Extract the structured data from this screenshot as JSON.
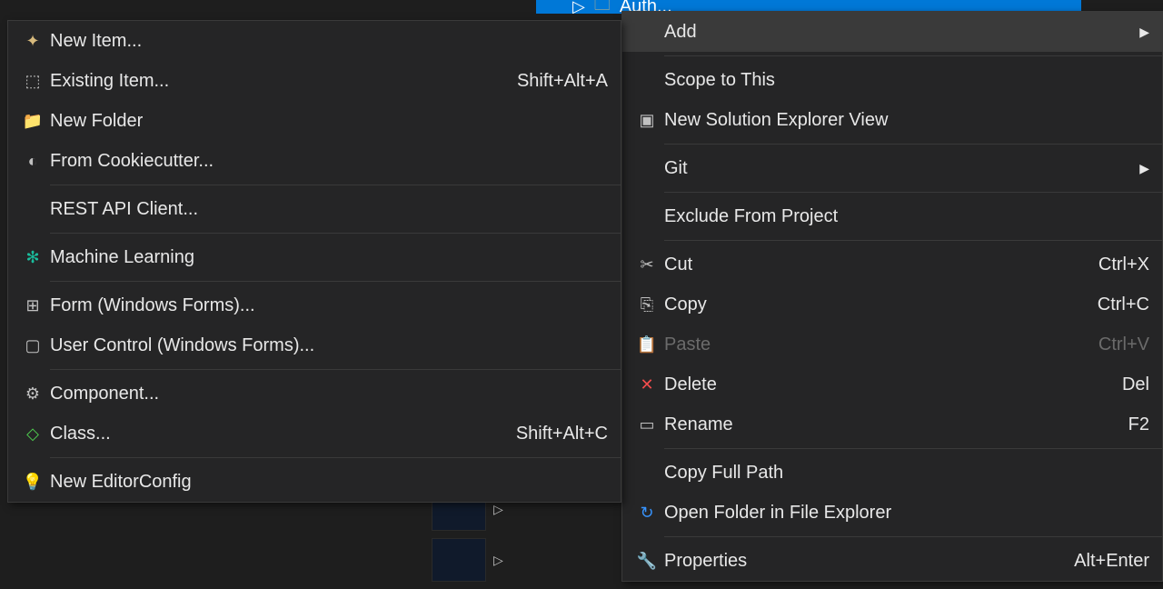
{
  "bgTab": {
    "text": "Auth..."
  },
  "leftMenu": {
    "items": [
      {
        "label": "New Item...",
        "shortcut": "",
        "iconName": "new-item-icon",
        "glyph": "✦",
        "glyphClass": "glyph-yellow"
      },
      {
        "label": "Existing Item...",
        "shortcut": "Shift+Alt+A",
        "iconName": "existing-item-icon",
        "glyph": "⬚",
        "glyphClass": ""
      },
      {
        "label": "New Folder",
        "shortcut": "",
        "iconName": "new-folder-icon",
        "glyph": "📁",
        "glyphClass": "glyph-yellow"
      },
      {
        "label": "From Cookiecutter...",
        "shortcut": "",
        "iconName": "cookiecutter-icon",
        "glyph": "◐",
        "glyphClass": ""
      },
      {
        "separator": true
      },
      {
        "label": "REST API Client...",
        "shortcut": "",
        "iconName": "",
        "glyph": "",
        "glyphClass": ""
      },
      {
        "separator": true
      },
      {
        "label": "Machine Learning",
        "shortcut": "",
        "iconName": "ml-icon",
        "glyph": "✻",
        "glyphClass": "glyph-teal"
      },
      {
        "separator": true
      },
      {
        "label": "Form (Windows Forms)...",
        "shortcut": "",
        "iconName": "form-icon",
        "glyph": "⊞",
        "glyphClass": ""
      },
      {
        "label": "User Control (Windows Forms)...",
        "shortcut": "",
        "iconName": "user-control-icon",
        "glyph": "▢",
        "glyphClass": ""
      },
      {
        "separator": true
      },
      {
        "label": "Component...",
        "shortcut": "",
        "iconName": "component-icon",
        "glyph": "⚙",
        "glyphClass": ""
      },
      {
        "label": "Class...",
        "shortcut": "Shift+Alt+C",
        "iconName": "class-icon",
        "glyph": "◇",
        "glyphClass": "glyph-green"
      },
      {
        "separator": true
      },
      {
        "label": "New EditorConfig",
        "shortcut": "",
        "iconName": "editorconfig-icon",
        "glyph": "💡",
        "glyphClass": ""
      }
    ]
  },
  "rightMenu": {
    "items": [
      {
        "label": "Add",
        "shortcut": "",
        "iconName": "",
        "glyph": "",
        "glyphClass": "",
        "hasSubmenu": true,
        "highlighted": true
      },
      {
        "separator": true
      },
      {
        "label": "Scope to This",
        "shortcut": "",
        "iconName": "",
        "glyph": "",
        "glyphClass": ""
      },
      {
        "label": "New Solution Explorer View",
        "shortcut": "",
        "iconName": "explorer-view-icon",
        "glyph": "▣",
        "glyphClass": ""
      },
      {
        "separator": true
      },
      {
        "label": "Git",
        "shortcut": "",
        "iconName": "",
        "glyph": "",
        "glyphClass": "",
        "hasSubmenu": true
      },
      {
        "separator": true
      },
      {
        "label": "Exclude From Project",
        "shortcut": "",
        "iconName": "",
        "glyph": "",
        "glyphClass": ""
      },
      {
        "separator": true
      },
      {
        "label": "Cut",
        "shortcut": "Ctrl+X",
        "iconName": "cut-icon",
        "glyph": "✂",
        "glyphClass": ""
      },
      {
        "label": "Copy",
        "shortcut": "Ctrl+C",
        "iconName": "copy-icon",
        "glyph": "⎘",
        "glyphClass": ""
      },
      {
        "label": "Paste",
        "shortcut": "Ctrl+V",
        "iconName": "paste-icon",
        "glyph": "📋",
        "glyphClass": "",
        "disabled": true
      },
      {
        "label": "Delete",
        "shortcut": "Del",
        "iconName": "delete-icon",
        "glyph": "✕",
        "glyphClass": "glyph-red"
      },
      {
        "label": "Rename",
        "shortcut": "F2",
        "iconName": "rename-icon",
        "glyph": "▭",
        "glyphClass": ""
      },
      {
        "separator": true
      },
      {
        "label": "Copy Full Path",
        "shortcut": "",
        "iconName": "",
        "glyph": "",
        "glyphClass": ""
      },
      {
        "label": "Open Folder in File Explorer",
        "shortcut": "",
        "iconName": "open-folder-icon",
        "glyph": "↻",
        "glyphClass": "glyph-blue"
      },
      {
        "separator": true
      },
      {
        "label": "Properties",
        "shortcut": "Alt+Enter",
        "iconName": "properties-icon",
        "glyph": "🔧",
        "glyphClass": ""
      }
    ]
  }
}
